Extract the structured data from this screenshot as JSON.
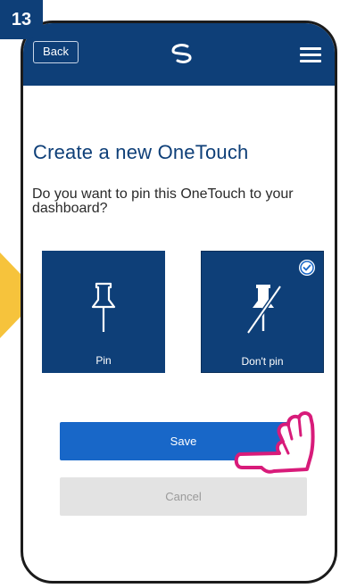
{
  "step": "13",
  "header": {
    "back_label": "Back",
    "logo_icon": "swirl-logo-icon",
    "menu_icon": "hamburger-menu-icon"
  },
  "page": {
    "title": "Create a new OneTouch",
    "question": "Do you want to pin this OneTouch to your dashboard?"
  },
  "options": [
    {
      "label": "Pin",
      "icon": "pushpin-icon",
      "selected": false
    },
    {
      "label": "Don't pin",
      "icon": "pushpin-crossed-icon",
      "selected": true
    }
  ],
  "actions": {
    "save_label": "Save",
    "cancel_label": "Cancel"
  },
  "colors": {
    "brand_navy": "#0e3f78",
    "primary_blue": "#1867c8",
    "disabled_gray": "#e3e3e3",
    "arrow_yellow": "#f6c33c",
    "hand_pink": "#d81b7a"
  }
}
